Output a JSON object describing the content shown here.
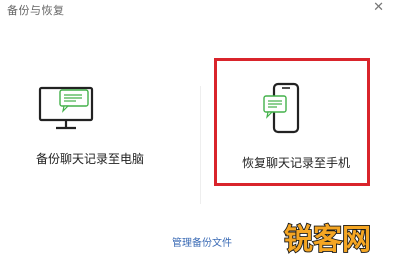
{
  "window": {
    "title": "备份与恢复",
    "close_glyph": "✕"
  },
  "options": {
    "pc": {
      "label": "备份聊天记录至电脑",
      "icon": "monitor-chat-icon"
    },
    "phone": {
      "label": "恢复聊天记录至手机",
      "icon": "phone-chat-icon",
      "highlight_color": "#d9242b"
    }
  },
  "footer": {
    "manage_label": "管理备份文件"
  },
  "watermark": {
    "text": "锐客网"
  },
  "colors": {
    "icon_chat": "#43b14a",
    "link": "#3b6bb5",
    "watermark_fill": "#f5a623",
    "watermark_stroke": "#1a1a1a"
  }
}
